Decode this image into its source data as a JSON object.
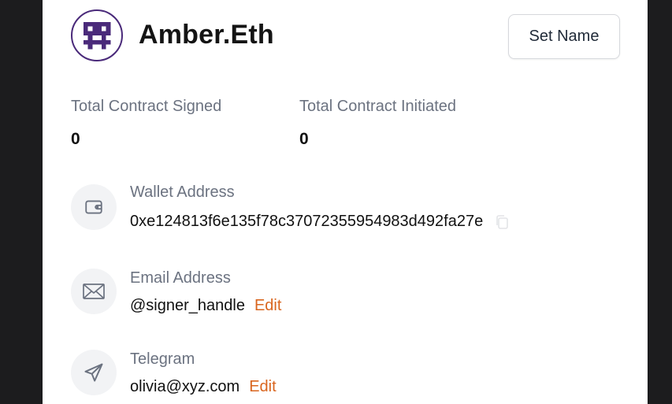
{
  "profile": {
    "name": "Amber.Eth",
    "set_name_label": "Set Name"
  },
  "stats": [
    {
      "label": "Total Contract Signed",
      "value": "0"
    },
    {
      "label": "Total Contract Initiated",
      "value": "0"
    }
  ],
  "wallet": {
    "label": "Wallet Address",
    "value": "0xe124813f6e135f78c37072355954983d492fa27e",
    "icon": "wallet-icon",
    "copy_icon": "copy-icon"
  },
  "email": {
    "label": "Email Address",
    "value": "@signer_handle",
    "edit_label": "Edit",
    "icon": "mail-icon"
  },
  "telegram": {
    "label": "Telegram",
    "value": "olivia@xyz.com",
    "edit_label": "Edit",
    "icon": "send-icon"
  },
  "colors": {
    "accent_edit": "#d9651e",
    "avatar_brand": "#4a2a7a",
    "background_dark": "#1c1c1e"
  }
}
